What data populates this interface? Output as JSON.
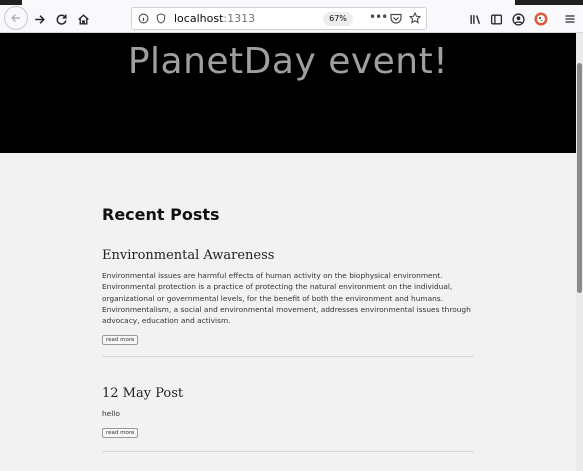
{
  "browser": {
    "url_host": "localhost",
    "url_port": ":1313",
    "zoom": "67%",
    "icons": [
      "back-icon",
      "forward-icon",
      "reload-icon",
      "home-icon",
      "site-info-icon",
      "page-actions-icon",
      "pocket-icon",
      "bookmark-star-icon",
      "library-icon",
      "sidebar-icon",
      "account-icon",
      "duckduckgo-icon",
      "menu-icon"
    ]
  },
  "page": {
    "hero_title": "PlanetDay event!",
    "section_title": "Recent Posts",
    "posts": [
      {
        "title": "Environmental Awareness",
        "body": "Environmental issues are harmful effects of human activity on the biophysical environment. Environmental protection is a practice of protecting the natural environment on the individual, organizational or governmental levels, for the benefit of both the environment and humans. Environmentalism, a social and environmental movement, addresses environmental issues through advocacy, education and activism.",
        "read_more": "read more"
      },
      {
        "title": "12 May Post",
        "body": "hello",
        "read_more": "read more"
      }
    ]
  },
  "colors": {
    "hero_bg": "#000000",
    "hero_text": "#9f9f9f",
    "page_bg": "#f2f2f2"
  }
}
